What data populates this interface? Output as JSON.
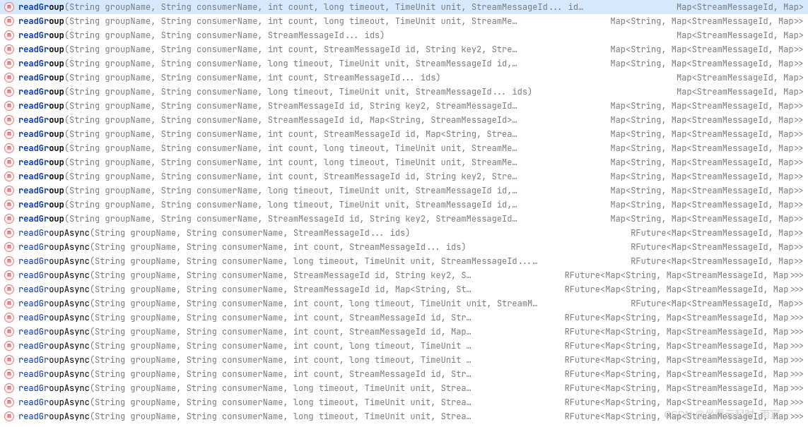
{
  "watermark": "CSDN @坐看云起时_雨宣",
  "items": [
    {
      "selected": true,
      "bold1": "readGr",
      "bold2": "oup",
      "gray": "(String groupName, String consumerName, int count, long timeout, TimeUnit unit, StreamMessageId... id…",
      "ret": "Map<StreamMessageId, Map>"
    },
    {
      "selected": false,
      "bold1": "readGr",
      "bold2": "oup",
      "gray": "(String groupName, String consumerName, int count, long timeout, TimeUnit unit, StreamMe…",
      "ret": "Map<String, Map<StreamMessageId, Map>>"
    },
    {
      "selected": false,
      "bold1": "readGr",
      "bold2": "oup",
      "gray": "(String groupName, String consumerName, StreamMessageId... ids)",
      "ret": "Map<StreamMessageId, Map>"
    },
    {
      "selected": false,
      "bold1": "readGr",
      "bold2": "oup",
      "gray": "(String groupName, String consumerName, int count, StreamMessageId id, String key2, Stre…",
      "ret": "Map<String, Map<StreamMessageId, Map>>"
    },
    {
      "selected": false,
      "bold1": "readGr",
      "bold2": "oup",
      "gray": "(String groupName, String consumerName, long timeout, TimeUnit unit, StreamMessageId id,…",
      "ret": "Map<String, Map<StreamMessageId, Map>>"
    },
    {
      "selected": false,
      "bold1": "readGr",
      "bold2": "oup",
      "gray": "(String groupName, String consumerName, int count, StreamMessageId... ids)",
      "ret": "Map<StreamMessageId, Map>"
    },
    {
      "selected": false,
      "bold1": "readGr",
      "bold2": "oup",
      "gray": "(String groupName, String consumerName, long timeout, TimeUnit unit, StreamMessageId... ids)",
      "ret": "Map<StreamMessageId, Map>"
    },
    {
      "selected": false,
      "bold1": "readGr",
      "bold2": "oup",
      "gray": "(String groupName, String consumerName, StreamMessageId id, String key2, StreamMessageId…",
      "ret": "Map<String, Map<StreamMessageId, Map>>"
    },
    {
      "selected": false,
      "bold1": "readGr",
      "bold2": "oup",
      "gray": "(String groupName, String consumerName, StreamMessageId id, Map<String, StreamMessageId>…",
      "ret": "Map<String, Map<StreamMessageId, Map>>"
    },
    {
      "selected": false,
      "bold1": "readGr",
      "bold2": "oup",
      "gray": "(String groupName, String consumerName, int count, StreamMessageId id, Map<String, Strea…",
      "ret": "Map<String, Map<StreamMessageId, Map>>"
    },
    {
      "selected": false,
      "bold1": "readGr",
      "bold2": "oup",
      "gray": "(String groupName, String consumerName, int count, long timeout, TimeUnit unit, StreamMe…",
      "ret": "Map<String, Map<StreamMessageId, Map>>"
    },
    {
      "selected": false,
      "bold1": "readGr",
      "bold2": "oup",
      "gray": "(String groupName, String consumerName, int count, long timeout, TimeUnit unit, StreamMe…",
      "ret": "Map<String, Map<StreamMessageId, Map>>"
    },
    {
      "selected": false,
      "bold1": "readGr",
      "bold2": "oup",
      "gray": "(String groupName, String consumerName, int count, StreamMessageId id, String key2, Stre…",
      "ret": "Map<String, Map<StreamMessageId, Map>>"
    },
    {
      "selected": false,
      "bold1": "readGr",
      "bold2": "oup",
      "gray": "(String groupName, String consumerName, long timeout, TimeUnit unit, StreamMessageId id,…",
      "ret": "Map<String, Map<StreamMessageId, Map>>"
    },
    {
      "selected": false,
      "bold1": "readGr",
      "bold2": "oup",
      "gray": "(String groupName, String consumerName, long timeout, TimeUnit unit, StreamMessageId id,…",
      "ret": "Map<String, Map<StreamMessageId, Map>>"
    },
    {
      "selected": false,
      "bold1": "readGr",
      "bold2": "oup",
      "gray": "(String groupName, String consumerName, StreamMessageId id, String key2, StreamMessageId…",
      "ret": "Map<String, Map<StreamMessageId, Map>>"
    },
    {
      "selected": false,
      "name": "readGroupAsync",
      "bold1": "readGr",
      "bold2": "oup",
      "mid": "Async",
      "gray": "(String groupName, String consumerName, StreamMessageId... ids)",
      "ret": "RFuture<Map<StreamMessageId, Map>>"
    },
    {
      "selected": false,
      "name": "readGroupAsync",
      "bold1": "readGr",
      "bold2": "oup",
      "mid": "Async",
      "gray": "(String groupName, String consumerName, int count, StreamMessageId... ids)",
      "ret": "RFuture<Map<StreamMessageId, Map>>"
    },
    {
      "selected": false,
      "name": "readGroupAsync",
      "bold1": "readGr",
      "bold2": "oup",
      "mid": "Async",
      "gray": "(String groupName, String consumerName, long timeout, TimeUnit unit, StreamMessageId...…",
      "ret": "RFuture<Map<StreamMessageId, Map>>"
    },
    {
      "selected": false,
      "name": "readGroupAsync",
      "bold1": "readGr",
      "bold2": "oup",
      "mid": "Async",
      "gray": "(String groupName, String consumerName, StreamMessageId id, String key2, S…",
      "ret": "RFuture<Map<String, Map<StreamMessageId, Map>>>"
    },
    {
      "selected": false,
      "name": "readGroupAsync",
      "bold1": "readGr",
      "bold2": "oup",
      "mid": "Async",
      "gray": "(String groupName, String consumerName, StreamMessageId id, Map<String, St…",
      "ret": "RFuture<Map<String, Map<StreamMessageId, Map>>>"
    },
    {
      "selected": false,
      "name": "readGroupAsync",
      "bold1": "readGr",
      "bold2": "oup",
      "mid": "Async",
      "gray": "(String groupName, String consumerName, int count, long timeout, TimeUnit unit, StreamM…",
      "ret": "RFuture<Map<StreamMessageId, Map>>"
    },
    {
      "selected": false,
      "name": "readGroupAsync",
      "bold1": "readGr",
      "bold2": "oup",
      "mid": "Async",
      "gray": "(String groupName, String consumerName, int count, StreamMessageId id, Str…",
      "ret": "RFuture<Map<String, Map<StreamMessageId, Map>>>"
    },
    {
      "selected": false,
      "name": "readGroupAsync",
      "bold1": "readGr",
      "bold2": "oup",
      "mid": "Async",
      "gray": "(String groupName, String consumerName, int count, StreamMessageId id, Map…",
      "ret": "RFuture<Map<String, Map<StreamMessageId, Map>>>"
    },
    {
      "selected": false,
      "name": "readGroupAsync",
      "bold1": "readGr",
      "bold2": "oup",
      "mid": "Async",
      "gray": "(String groupName, String consumerName, int count, long timeout, TimeUnit …",
      "ret": "RFuture<Map<String, Map<StreamMessageId, Map>>>"
    },
    {
      "selected": false,
      "name": "readGroupAsync",
      "bold1": "readGr",
      "bold2": "oup",
      "mid": "Async",
      "gray": "(String groupName, String consumerName, int count, long timeout, TimeUnit …",
      "ret": "RFuture<Map<String, Map<StreamMessageId, Map>>>"
    },
    {
      "selected": false,
      "name": "readGroupAsync",
      "bold1": "readGr",
      "bold2": "oup",
      "mid": "Async",
      "gray": "(String groupName, String consumerName, int count, StreamMessageId id, Str…",
      "ret": "RFuture<Map<String, Map<StreamMessageId, Map>>>"
    },
    {
      "selected": false,
      "name": "readGroupAsync",
      "bold1": "readGr",
      "bold2": "oup",
      "mid": "Async",
      "gray": "(String groupName, String consumerName, long timeout, TimeUnit unit, Strea…",
      "ret": "RFuture<Map<String, Map<StreamMessageId, Map>>>"
    },
    {
      "selected": false,
      "name": "readGroupAsync",
      "bold1": "readGr",
      "bold2": "oup",
      "mid": "Async",
      "gray": "(String groupName, String consumerName, long timeout, TimeUnit unit, Strea…",
      "ret": "RFuture<Map<String, Map<StreamMessageId, Map>>>"
    },
    {
      "selected": false,
      "name": "readGroupAsync",
      "bold1": "readGr",
      "bold2": "oup",
      "mid": "Async",
      "gray": "(String groupName, String consumerName, long timeout, TimeUnit unit, Strea…",
      "ret": "RFuture<Map<String, Map<StreamMessageId, Map>>>"
    }
  ]
}
